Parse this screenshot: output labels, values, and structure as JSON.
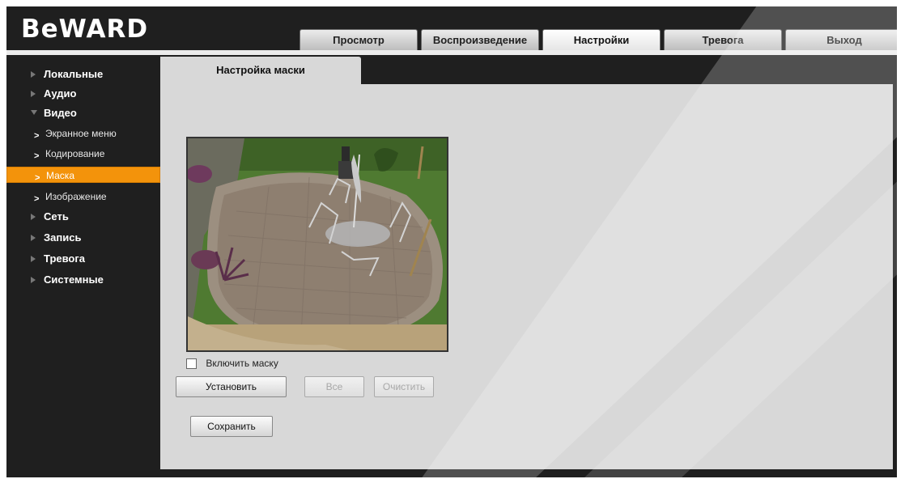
{
  "brand": {
    "logo_text": "BeWARD"
  },
  "nav_tabs": [
    {
      "label": "Просмотр"
    },
    {
      "label": "Воспроизведение"
    },
    {
      "label": "Настройки"
    },
    {
      "label": "Тревога"
    },
    {
      "label": "Выход"
    }
  ],
  "active_tab": "Настройки",
  "sidebar": {
    "items": [
      {
        "label": "Локальные",
        "kind": "category"
      },
      {
        "label": "Аудио",
        "kind": "category"
      },
      {
        "label": "Видео",
        "kind": "category",
        "expanded": true
      },
      {
        "label": "Экранное меню",
        "kind": "sub"
      },
      {
        "label": "Кодирование",
        "kind": "sub"
      },
      {
        "label": "Маска",
        "kind": "sub",
        "active": true
      },
      {
        "label": "Изображение",
        "kind": "sub"
      },
      {
        "label": "Сеть",
        "kind": "category"
      },
      {
        "label": "Запись",
        "kind": "category"
      },
      {
        "label": "Тревога",
        "kind": "category"
      },
      {
        "label": "Системные",
        "kind": "category"
      }
    ]
  },
  "content": {
    "tab_title": "Настройка маски",
    "enable_mask_label": "Включить маску",
    "enable_mask_checked": false,
    "buttons": {
      "set": "Установить",
      "all": "Все",
      "clear": "Очистить",
      "save": "Сохранить"
    }
  },
  "colors": {
    "accent": "#f3930b",
    "background": "#1f1f1f",
    "panel": "#d8d8d8"
  },
  "icons": {
    "category_collapsed": "triangle-right-icon",
    "category_expanded": "triangle-down-icon",
    "sub_item": "chevron-right-icon"
  }
}
